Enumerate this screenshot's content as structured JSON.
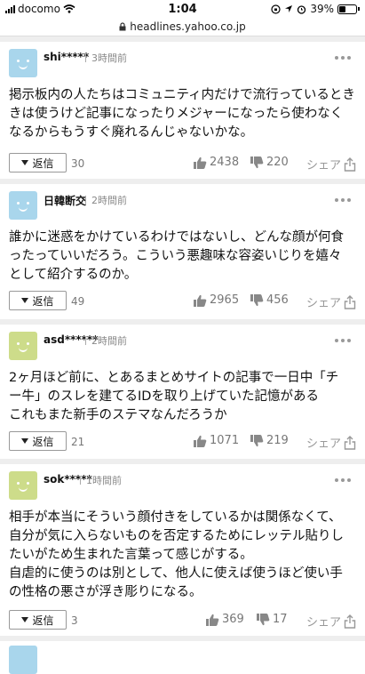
{
  "status": {
    "carrier": "docomo",
    "time": "1:04",
    "battery": "39%",
    "battery_level": 0.39
  },
  "url": "headlines.yahoo.co.jp",
  "labels": {
    "reply": "返信",
    "share": "シェア"
  },
  "comments": [
    {
      "user": "shi*****",
      "time": "3時間前",
      "avatar_color": "#a9d6ec",
      "lines": [
        "掲示板内の人たちはコミュニティ内だけで流行っているとき",
        "きは使うけど記事になったりメジャーになったら使わなく",
        "なるからもうすぐ廃れるんじゃないかな。"
      ],
      "replies": "30",
      "likes": "2438",
      "dislikes": "220"
    },
    {
      "user": "日韓断交",
      "time": "2時間前",
      "avatar_color": "#a9d6ec",
      "lines": [
        "誰かに迷惑をかけているわけではないし、どんな顔が何食",
        "ったっていいだろう。こういう悪趣味な容姿いじりを嬉々",
        "として紹介するのか。"
      ],
      "replies": "49",
      "likes": "2965",
      "dislikes": "456"
    },
    {
      "user": "asd******",
      "time": "2時間前",
      "avatar_color": "#cddc8a",
      "lines": [
        "2ヶ月ほど前に、とあるまとめサイトの記事で一日中「チ",
        "ー牛」のスレを建てるIDを取り上げていた記憶がある",
        "これもまた新手のステマなんだろうか"
      ],
      "replies": "21",
      "likes": "1071",
      "dislikes": "219"
    },
    {
      "user": "sok*****",
      "time": "1時間前",
      "avatar_color": "#cddc8a",
      "lines": [
        "相手が本当にそういう顔付きをしているかは関係なくて、",
        "自分が気に入らないものを否定するためにレッテル貼りし",
        "たいがため生まれた言葉って感じがする。",
        "自虐的に使うのは別として、他人に使えば使うほど使い手",
        "の性格の悪さが浮き彫りになる。"
      ],
      "replies": "3",
      "likes": "369",
      "dislikes": "17"
    }
  ]
}
